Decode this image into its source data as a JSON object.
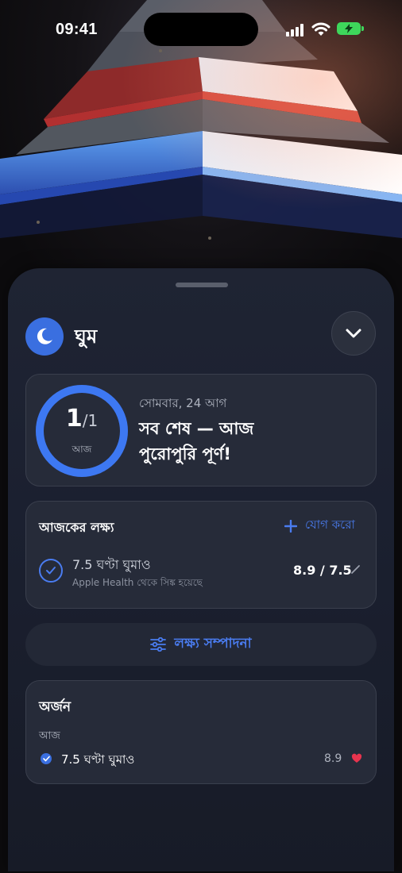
{
  "status_bar": {
    "time": "09:41"
  },
  "category": {
    "name": "ঘুম",
    "icon": "moon-icon"
  },
  "progress": {
    "completed": "1",
    "total": "1",
    "period_label": "আজ",
    "date": "সোমবার, 24 আগ",
    "message": "সব শেষ — আজ পুরোপুরি পূর্ণ!",
    "fraction": 1.0
  },
  "goals": {
    "title": "আজকের লক্ষ্য",
    "add_label": "যোগ করো",
    "items": [
      {
        "name": "7.5 ঘণ্টা ঘুমাও",
        "source": "Apple Health থেকে সিঙ্ক হয়েছে",
        "progress": "8.9 / 7.5"
      }
    ]
  },
  "edit_goals_label": "লক্ষ্য সম্পাদনা",
  "achievements": {
    "title": "অর্জন",
    "section": "আজ",
    "items": [
      {
        "name": "7.5 ঘণ্টা ঘুমাও",
        "value": "8.9"
      }
    ]
  },
  "colors": {
    "accent": "#4a7cf0",
    "battery": "#3ed65b",
    "heart": "#e8344e"
  }
}
